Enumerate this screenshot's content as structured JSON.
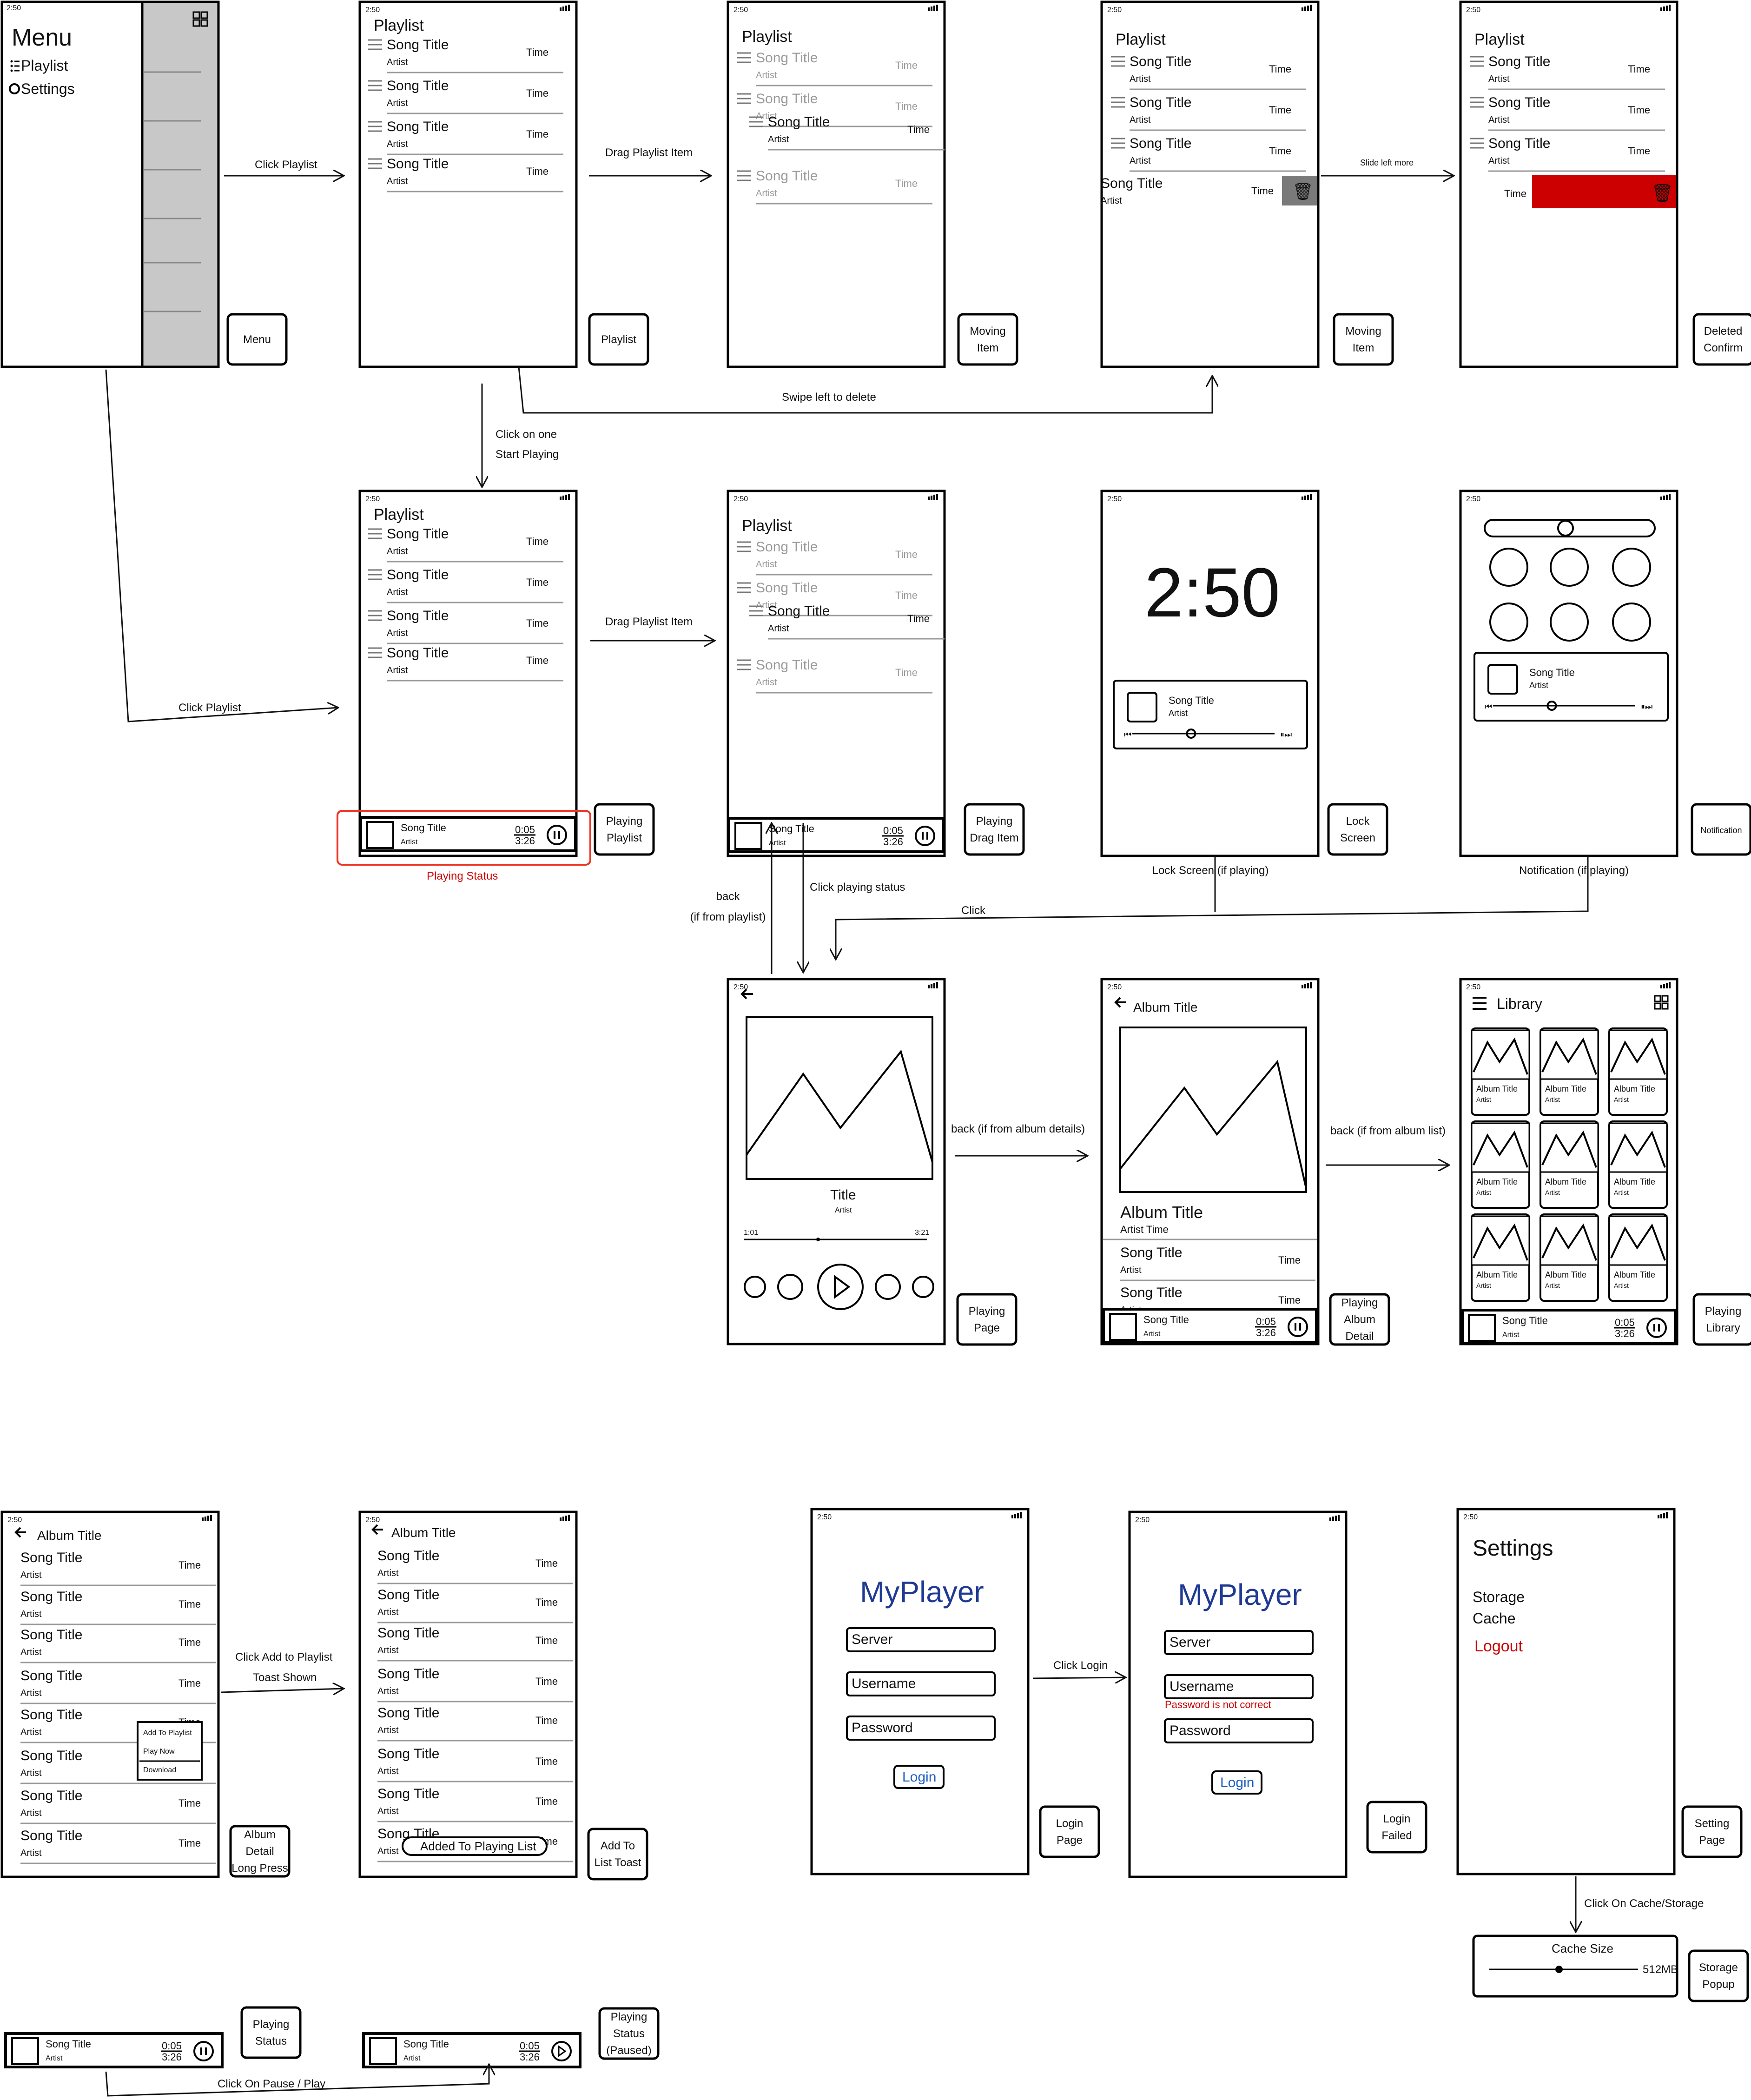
{
  "status_time": "2:50",
  "common": {
    "playlist": "Playlist",
    "song_title": "Song Title",
    "artist": "Artist",
    "time": "Time",
    "album_title": "Album Title",
    "title": "Title",
    "elapsed": "0:05",
    "total": "3:26"
  },
  "menu": {
    "title": "Menu",
    "items": [
      "Playlist",
      "Settings"
    ]
  },
  "screen_labels": [
    "Menu",
    "Playlist",
    "Moving Item",
    "Moving Item",
    "Deleted Confirm",
    "Playing Playlist",
    "Playing Drag Item",
    "Lock Screen",
    "Notification",
    "Playing Page",
    "Playing Album Detail",
    "Playing Library",
    "Album Detail Long Press",
    "Add To List Toast",
    "Login Page",
    "Login Failed",
    "Setting Page",
    "Playing Status",
    "Playing Status (Paused)",
    "Storage Popup"
  ],
  "arrows": {
    "click_playlist": "Click Playlist",
    "drag_playlist_item": "Drag Playlist Item",
    "slide_left_more": "Slide left more",
    "swipe_left_delete": "Swipe left to delete",
    "click_one_start": [
      "Click on one",
      "Start Playing"
    ],
    "back_from_playlist": [
      "back",
      "(if from playlist)"
    ],
    "click_playing_status": "Click playing status",
    "lock_screen_if_playing": "Lock Screen (if playing)",
    "notification_if_playing": "Notification  (if playing)",
    "click": "Click",
    "back_album_details": "back (if from album details)",
    "back_album_list": "back (if from album list)",
    "click_add_playlist": [
      "Click Add to Playlist",
      "Toast Shown"
    ],
    "click_login": "Click Login",
    "click_cache_storage": "Click On Cache/Storage",
    "click_pause_play": "Click On Pause / Play"
  },
  "playing_status_caption": "Playing Status",
  "lock_screen": {
    "clock": "2:50"
  },
  "player": {
    "title": "Title",
    "artist": "Artist",
    "position": "1:01",
    "duration": "3:21"
  },
  "album_detail": {
    "header": "Album Title",
    "title": "Album Title",
    "meta": "Artist Time"
  },
  "library": {
    "title": "Library"
  },
  "context_menu": [
    "Add To Playlist",
    "Play Now",
    "Download"
  ],
  "toast": "Added To Playing List",
  "login": {
    "app_name": "MyPlayer",
    "server": "Server",
    "username": "Username",
    "password": "Password",
    "button": "Login",
    "error": "Password is not correct"
  },
  "settings": {
    "title": "Settings",
    "items": [
      "Storage",
      "Cache"
    ],
    "logout": "Logout"
  },
  "storage_popup": {
    "title": "Cache Size",
    "value": "512MB"
  },
  "colors": {
    "accent_red": "#cc0000",
    "brand_blue": "#1f3a93",
    "link_blue": "#1d5fbf",
    "delete_grey": "#7a7a7a",
    "sidebar_grey": "#c8c8c8"
  }
}
